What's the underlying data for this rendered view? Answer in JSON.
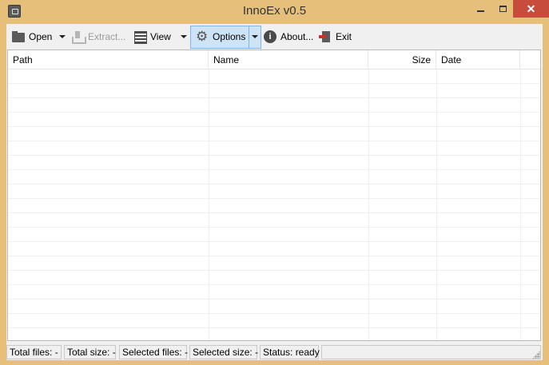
{
  "window": {
    "title": "InnoEx v0.5"
  },
  "toolbar": {
    "open_label": "Open",
    "extract_label": "Extract...",
    "view_label": "View",
    "options_label": "Options",
    "about_label": "About...",
    "exit_label": "Exit"
  },
  "list": {
    "columns": [
      "Path",
      "Name",
      "Size",
      "Date"
    ]
  },
  "status": {
    "total_files": "Total files:  -",
    "total_size": "Total size:  -",
    "selected_files": "Selected files:  -",
    "selected_size": "Selected size:  -",
    "status": "Status:  ready"
  },
  "colors": {
    "frame": "#e6c07a",
    "close_button": "#c74c3c",
    "options_highlight": "#cde4f7"
  }
}
